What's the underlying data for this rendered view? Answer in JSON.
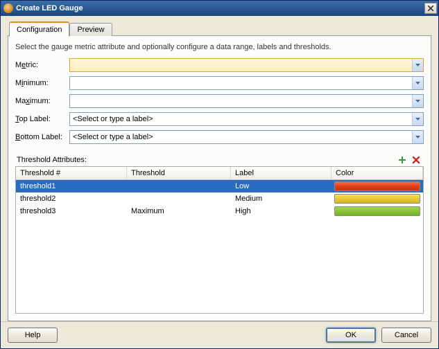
{
  "window": {
    "title": "Create LED Gauge"
  },
  "tabs": {
    "configuration": "Configuration",
    "preview": "Preview"
  },
  "description": "Select the gauge metric attribute and optionally configure a data range, labels and thresholds.",
  "form": {
    "metric": {
      "label_pre": "M",
      "label_u": "e",
      "label_post": "tric:",
      "value": ""
    },
    "minimum": {
      "label_pre": "M",
      "label_u": "i",
      "label_post": "nimum:",
      "value": ""
    },
    "maximum": {
      "label_pre": "Ma",
      "label_u": "x",
      "label_post": "imum:",
      "value": ""
    },
    "top_label": {
      "label_u": "T",
      "label_post": "op Label:",
      "value": "<Select or type a label>"
    },
    "bottom_label": {
      "label_u": "B",
      "label_post": "ottom Label:",
      "value": "<Select or type a label>"
    }
  },
  "threshold_section_title": "Threshold Attributes:",
  "columns": {
    "c0": "Threshold #",
    "c1": "Threshold",
    "c2": "Label",
    "c3": "Color"
  },
  "rows": [
    {
      "id": "threshold1",
      "threshold": "",
      "label": "Low",
      "color": "red",
      "selected": true
    },
    {
      "id": "threshold2",
      "threshold": "",
      "label": "Medium",
      "color": "yellow",
      "selected": false
    },
    {
      "id": "threshold3",
      "threshold": "Maximum",
      "label": "High",
      "color": "green",
      "selected": false
    }
  ],
  "buttons": {
    "help": "Help",
    "ok": "OK",
    "cancel": "Cancel"
  }
}
